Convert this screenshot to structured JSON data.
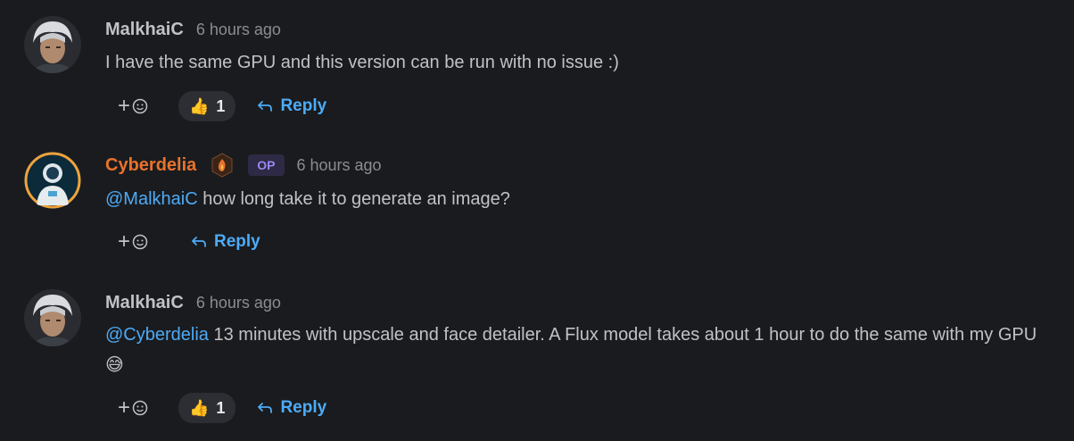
{
  "comments": [
    {
      "username": "MalkhaiC",
      "timestamp": "6 hours ago",
      "text": "I have the same GPU and this version can be run with no issue :)",
      "reaction": {
        "emoji": "👍",
        "count": "1"
      },
      "reply_label": "Reply"
    },
    {
      "username": "Cyberdelia",
      "op_label": "OP",
      "timestamp": "6 hours ago",
      "mention": "@MalkhaiC",
      "text": " how long take it to generate an image?",
      "reply_label": "Reply"
    },
    {
      "username": "MalkhaiC",
      "timestamp": "6 hours ago",
      "mention": "@Cyberdelia",
      "text": " 13 minutes with upscale and face detailer. A Flux model takes about 1 hour to do the same with my GPU",
      "trailing_emoji": "😅",
      "reaction": {
        "emoji": "👍",
        "count": "1"
      },
      "reply_label": "Reply"
    }
  ],
  "icons": {
    "add_reaction": "plus-smile-icon",
    "reply": "reply-arrow-icon",
    "creator_badge": "fire-badge-icon"
  },
  "colors": {
    "background": "#1a1b1e",
    "link": "#4dabf7",
    "op_username": "#e8732c",
    "op_badge_bg": "#2e2a45",
    "op_badge_text": "#9b87f5"
  }
}
